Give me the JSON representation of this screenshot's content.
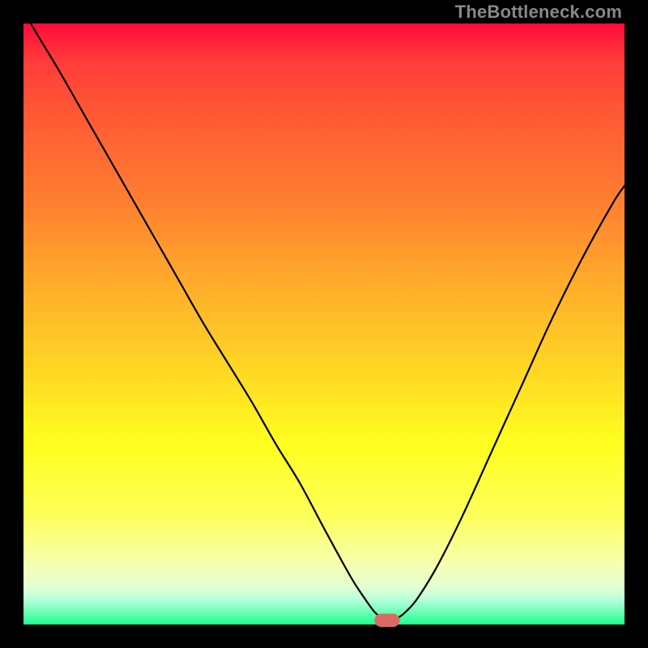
{
  "attribution": "TheBottleneck.com",
  "colors": {
    "curve": "#000000",
    "marker": "#d96b63",
    "frame": "#000000"
  },
  "chart_data": {
    "type": "line",
    "title": "",
    "xlabel": "",
    "ylabel": "",
    "xlim": [
      0,
      100
    ],
    "ylim": [
      0,
      100
    ],
    "grid": false,
    "legend": false,
    "series": [
      {
        "name": "bottleneck-curve",
        "x": [
          0,
          3,
          6,
          10,
          14,
          18,
          22,
          26,
          30,
          34,
          38,
          42,
          46,
          50,
          53,
          55,
          57,
          58.5,
          60,
          62,
          64,
          66,
          69,
          73,
          78,
          83,
          88,
          93,
          98,
          100
        ],
        "values": [
          102,
          97,
          92,
          85,
          78,
          71,
          64,
          57,
          50,
          43.5,
          37,
          30,
          23.5,
          16,
          10.5,
          7,
          4,
          2,
          1,
          1,
          2.5,
          5,
          10,
          18,
          29,
          40,
          51,
          61,
          70,
          73
        ]
      }
    ],
    "marker": {
      "x": 60.5,
      "y": 0.7,
      "width": 4.2,
      "height": 2.2
    }
  }
}
